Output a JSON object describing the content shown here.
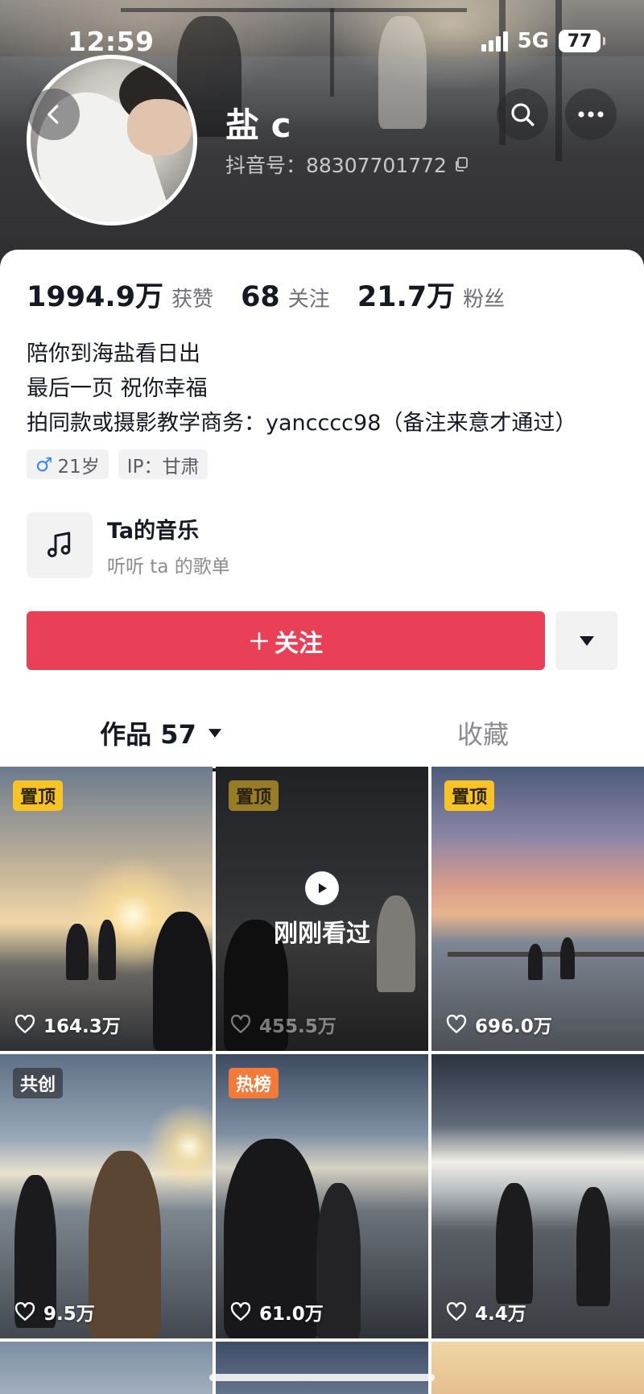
{
  "status_bar": {
    "time": "12:59",
    "network": "5G",
    "battery": "77"
  },
  "profile": {
    "nickname": "盐 c",
    "douyin_id": "抖音号：88307701772"
  },
  "stats": [
    {
      "value": "1994.9万",
      "label": "获赞"
    },
    {
      "value": "68",
      "label": "关注"
    },
    {
      "value": "21.7万",
      "label": "粉丝"
    }
  ],
  "bio": [
    "陪你到海盐看日出",
    "最后一页 祝你幸福",
    "拍同款或摄影教学商务：yancccc98（备注来意才通过）"
  ],
  "tags": {
    "gender_icon": "♂",
    "age": "21岁",
    "ip": "IP：甘肃"
  },
  "music": {
    "title": "Ta的音乐",
    "subtitle": "听听 ta 的歌单"
  },
  "follow_button": {
    "label": "关注"
  },
  "tabs": {
    "works_label": "作品 57",
    "favorites_label": "收藏"
  },
  "videos": [
    {
      "badge": "置顶",
      "likes": "164.3万"
    },
    {
      "badge": "置顶",
      "likes": "455.5万",
      "overlay": "刚刚看过"
    },
    {
      "badge": "置顶",
      "likes": "696.0万"
    },
    {
      "badge": "共创",
      "likes": "9.5万"
    },
    {
      "badge": "热榜",
      "likes": "61.0万"
    },
    {
      "likes": "4.4万"
    }
  ],
  "colors": {
    "accent": "#ea4057",
    "pin_badge": "#f7c325",
    "hot_badge": "#f47a3a"
  }
}
